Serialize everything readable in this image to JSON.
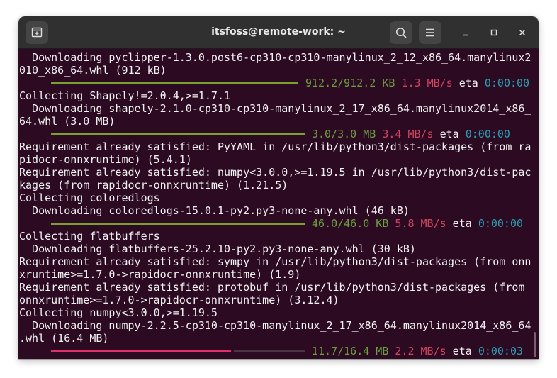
{
  "window": {
    "title": "itsfoss@remote-work: ~"
  },
  "icons": {
    "new_tab": "new-tab-icon",
    "search": "search-icon",
    "menu": "hamburger-menu-icon",
    "minimize": "minimize-icon",
    "maximize": "maximize-icon",
    "close": "close-icon"
  },
  "colors": {
    "terminal_background": "#2c0a22",
    "titlebar": "#303030",
    "progress_complete": "#7aa12f",
    "progress_partial": "#e0306a",
    "size_text": "#6a9f3e",
    "speed_text": "#d3455f",
    "eta_text": "#2a9fb4"
  },
  "terminal": {
    "lines": [
      {
        "segments": [
          {
            "text": "  Downloading pyclipper-1.3.0.post6-cp310-cp310-manylinux_2_12_x86_64.manylinux2",
            "color": "white"
          }
        ]
      },
      {
        "segments": [
          {
            "text": "010_x86_64.whl (912 kB)",
            "color": "white"
          }
        ]
      },
      {
        "progress": 1.0,
        "segments": [
          {
            "text": "912.2/912.2 KB",
            "color": "green"
          },
          {
            "text": " ",
            "color": "white"
          },
          {
            "text": "1.3 MB/s",
            "color": "red"
          },
          {
            "text": " eta ",
            "color": "white"
          },
          {
            "text": "0:00:00",
            "color": "cyan"
          }
        ]
      },
      {
        "segments": [
          {
            "text": "Collecting Shapely!=2.0.4,>=1.7.1",
            "color": "white"
          }
        ]
      },
      {
        "segments": [
          {
            "text": "  Downloading shapely-2.1.0-cp310-cp310-manylinux_2_17_x86_64.manylinux2014_x86_",
            "color": "white"
          }
        ]
      },
      {
        "segments": [
          {
            "text": "64.whl (3.0 MB)",
            "color": "white"
          }
        ]
      },
      {
        "progress": 1.0,
        "segments": [
          {
            "text": "3.0/3.0 MB",
            "color": "green"
          },
          {
            "text": " ",
            "color": "white"
          },
          {
            "text": "3.4 MB/s",
            "color": "red"
          },
          {
            "text": " eta ",
            "color": "white"
          },
          {
            "text": "0:00:00",
            "color": "cyan"
          }
        ]
      },
      {
        "segments": [
          {
            "text": "Requirement already satisfied: PyYAML in /usr/lib/python3/dist-packages (from ra",
            "color": "white"
          }
        ]
      },
      {
        "segments": [
          {
            "text": "pidocr-onnxruntime) (5.4.1)",
            "color": "white"
          }
        ]
      },
      {
        "segments": [
          {
            "text": "Requirement already satisfied: numpy<3.0.0,>=1.19.5 in /usr/lib/python3/dist-pac",
            "color": "white"
          }
        ]
      },
      {
        "segments": [
          {
            "text": "kages (from rapidocr-onnxruntime) (1.21.5)",
            "color": "white"
          }
        ]
      },
      {
        "segments": [
          {
            "text": "Collecting coloredlogs",
            "color": "white"
          }
        ]
      },
      {
        "segments": [
          {
            "text": "  Downloading coloredlogs-15.0.1-py2.py3-none-any.whl (46 kB)",
            "color": "white"
          }
        ]
      },
      {
        "progress": 1.0,
        "segments": [
          {
            "text": "46.0/46.0 KB",
            "color": "green"
          },
          {
            "text": " ",
            "color": "white"
          },
          {
            "text": "5.8 MB/s",
            "color": "red"
          },
          {
            "text": " eta ",
            "color": "white"
          },
          {
            "text": "0:00:00",
            "color": "cyan"
          }
        ]
      },
      {
        "segments": [
          {
            "text": "Collecting flatbuffers",
            "color": "white"
          }
        ]
      },
      {
        "segments": [
          {
            "text": "  Downloading flatbuffers-25.2.10-py2.py3-none-any.whl (30 kB)",
            "color": "white"
          }
        ]
      },
      {
        "segments": [
          {
            "text": "Requirement already satisfied: sympy in /usr/lib/python3/dist-packages (from onn",
            "color": "white"
          }
        ]
      },
      {
        "segments": [
          {
            "text": "xruntime>=1.7.0->rapidocr-onnxruntime) (1.9)",
            "color": "white"
          }
        ]
      },
      {
        "segments": [
          {
            "text": "Requirement already satisfied: protobuf in /usr/lib/python3/dist-packages (from",
            "color": "white"
          }
        ]
      },
      {
        "segments": [
          {
            "text": "onnxruntime>=1.7.0->rapidocr-onnxruntime) (3.12.4)",
            "color": "white"
          }
        ]
      },
      {
        "segments": [
          {
            "text": "Collecting numpy<3.0.0,>=1.19.5",
            "color": "white"
          }
        ]
      },
      {
        "segments": [
          {
            "text": "  Downloading numpy-2.2.5-cp310-cp310-manylinux_2_17_x86_64.manylinux2014_x86_64",
            "color": "white"
          }
        ]
      },
      {
        "segments": [
          {
            "text": ".whl (16.4 MB)",
            "color": "white"
          }
        ]
      },
      {
        "progress": 0.71,
        "segments": [
          {
            "text": "11.7/16.4 MB",
            "color": "green"
          },
          {
            "text": " ",
            "color": "white"
          },
          {
            "text": "2.2 MB/s",
            "color": "red"
          },
          {
            "text": " eta ",
            "color": "white"
          },
          {
            "text": "0:00:03",
            "color": "cyan"
          }
        ]
      }
    ]
  }
}
